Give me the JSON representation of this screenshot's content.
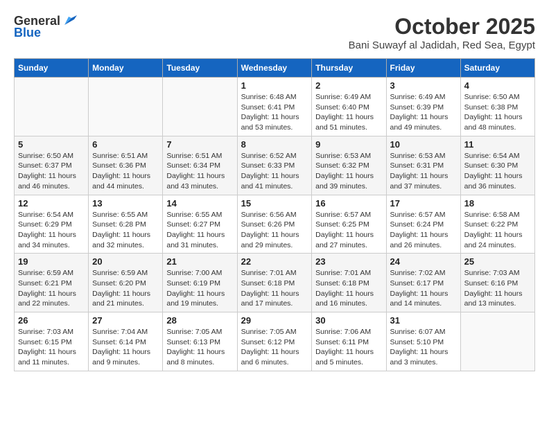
{
  "header": {
    "logo_line1": "General",
    "logo_line2": "Blue",
    "month_title": "October 2025",
    "location": "Bani Suwayf al Jadidah, Red Sea, Egypt"
  },
  "weekdays": [
    "Sunday",
    "Monday",
    "Tuesday",
    "Wednesday",
    "Thursday",
    "Friday",
    "Saturday"
  ],
  "weeks": [
    [
      {
        "day": "",
        "info": ""
      },
      {
        "day": "",
        "info": ""
      },
      {
        "day": "",
        "info": ""
      },
      {
        "day": "1",
        "info": "Sunrise: 6:48 AM\nSunset: 6:41 PM\nDaylight: 11 hours and 53 minutes."
      },
      {
        "day": "2",
        "info": "Sunrise: 6:49 AM\nSunset: 6:40 PM\nDaylight: 11 hours and 51 minutes."
      },
      {
        "day": "3",
        "info": "Sunrise: 6:49 AM\nSunset: 6:39 PM\nDaylight: 11 hours and 49 minutes."
      },
      {
        "day": "4",
        "info": "Sunrise: 6:50 AM\nSunset: 6:38 PM\nDaylight: 11 hours and 48 minutes."
      }
    ],
    [
      {
        "day": "5",
        "info": "Sunrise: 6:50 AM\nSunset: 6:37 PM\nDaylight: 11 hours and 46 minutes."
      },
      {
        "day": "6",
        "info": "Sunrise: 6:51 AM\nSunset: 6:36 PM\nDaylight: 11 hours and 44 minutes."
      },
      {
        "day": "7",
        "info": "Sunrise: 6:51 AM\nSunset: 6:34 PM\nDaylight: 11 hours and 43 minutes."
      },
      {
        "day": "8",
        "info": "Sunrise: 6:52 AM\nSunset: 6:33 PM\nDaylight: 11 hours and 41 minutes."
      },
      {
        "day": "9",
        "info": "Sunrise: 6:53 AM\nSunset: 6:32 PM\nDaylight: 11 hours and 39 minutes."
      },
      {
        "day": "10",
        "info": "Sunrise: 6:53 AM\nSunset: 6:31 PM\nDaylight: 11 hours and 37 minutes."
      },
      {
        "day": "11",
        "info": "Sunrise: 6:54 AM\nSunset: 6:30 PM\nDaylight: 11 hours and 36 minutes."
      }
    ],
    [
      {
        "day": "12",
        "info": "Sunrise: 6:54 AM\nSunset: 6:29 PM\nDaylight: 11 hours and 34 minutes."
      },
      {
        "day": "13",
        "info": "Sunrise: 6:55 AM\nSunset: 6:28 PM\nDaylight: 11 hours and 32 minutes."
      },
      {
        "day": "14",
        "info": "Sunrise: 6:55 AM\nSunset: 6:27 PM\nDaylight: 11 hours and 31 minutes."
      },
      {
        "day": "15",
        "info": "Sunrise: 6:56 AM\nSunset: 6:26 PM\nDaylight: 11 hours and 29 minutes."
      },
      {
        "day": "16",
        "info": "Sunrise: 6:57 AM\nSunset: 6:25 PM\nDaylight: 11 hours and 27 minutes."
      },
      {
        "day": "17",
        "info": "Sunrise: 6:57 AM\nSunset: 6:24 PM\nDaylight: 11 hours and 26 minutes."
      },
      {
        "day": "18",
        "info": "Sunrise: 6:58 AM\nSunset: 6:22 PM\nDaylight: 11 hours and 24 minutes."
      }
    ],
    [
      {
        "day": "19",
        "info": "Sunrise: 6:59 AM\nSunset: 6:21 PM\nDaylight: 11 hours and 22 minutes."
      },
      {
        "day": "20",
        "info": "Sunrise: 6:59 AM\nSunset: 6:20 PM\nDaylight: 11 hours and 21 minutes."
      },
      {
        "day": "21",
        "info": "Sunrise: 7:00 AM\nSunset: 6:19 PM\nDaylight: 11 hours and 19 minutes."
      },
      {
        "day": "22",
        "info": "Sunrise: 7:01 AM\nSunset: 6:18 PM\nDaylight: 11 hours and 17 minutes."
      },
      {
        "day": "23",
        "info": "Sunrise: 7:01 AM\nSunset: 6:18 PM\nDaylight: 11 hours and 16 minutes."
      },
      {
        "day": "24",
        "info": "Sunrise: 7:02 AM\nSunset: 6:17 PM\nDaylight: 11 hours and 14 minutes."
      },
      {
        "day": "25",
        "info": "Sunrise: 7:03 AM\nSunset: 6:16 PM\nDaylight: 11 hours and 13 minutes."
      }
    ],
    [
      {
        "day": "26",
        "info": "Sunrise: 7:03 AM\nSunset: 6:15 PM\nDaylight: 11 hours and 11 minutes."
      },
      {
        "day": "27",
        "info": "Sunrise: 7:04 AM\nSunset: 6:14 PM\nDaylight: 11 hours and 9 minutes."
      },
      {
        "day": "28",
        "info": "Sunrise: 7:05 AM\nSunset: 6:13 PM\nDaylight: 11 hours and 8 minutes."
      },
      {
        "day": "29",
        "info": "Sunrise: 7:05 AM\nSunset: 6:12 PM\nDaylight: 11 hours and 6 minutes."
      },
      {
        "day": "30",
        "info": "Sunrise: 7:06 AM\nSunset: 6:11 PM\nDaylight: 11 hours and 5 minutes."
      },
      {
        "day": "31",
        "info": "Sunrise: 6:07 AM\nSunset: 5:10 PM\nDaylight: 11 hours and 3 minutes."
      },
      {
        "day": "",
        "info": ""
      }
    ]
  ]
}
